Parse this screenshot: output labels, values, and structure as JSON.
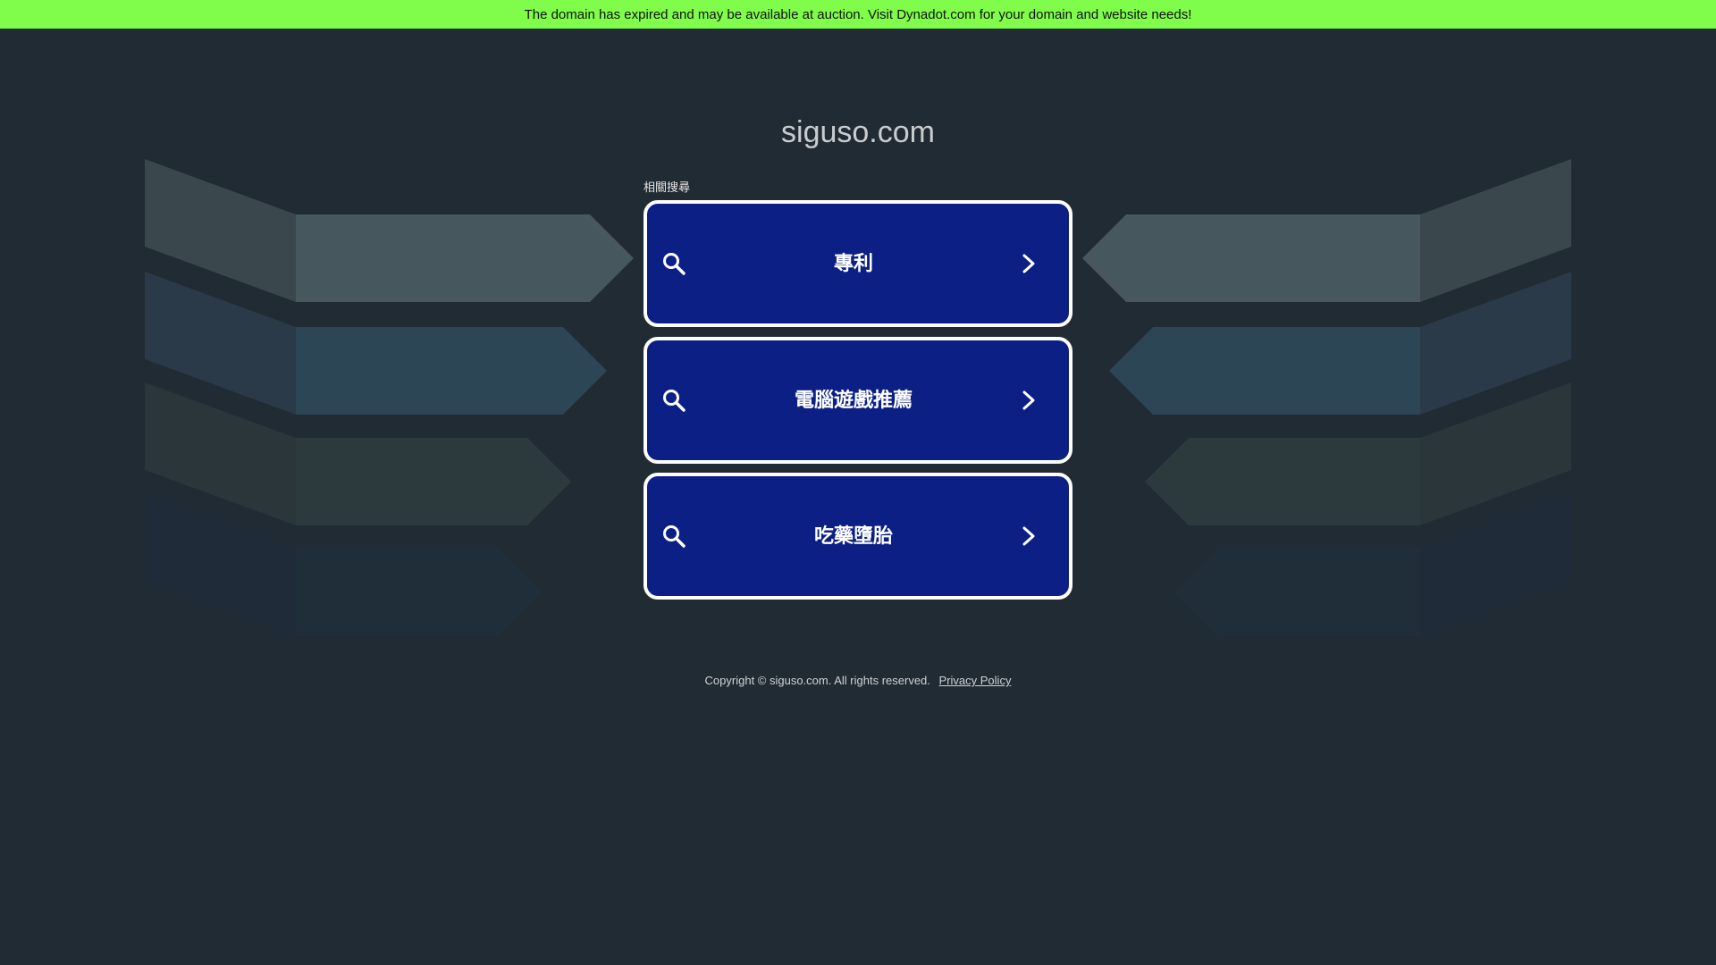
{
  "banner": {
    "text": "The domain has expired and may be available at auction. Visit Dynadot.com for your domain and website needs!"
  },
  "site": {
    "title": "siguso.com"
  },
  "related": {
    "label": "相關搜尋",
    "items": [
      {
        "label": "專利"
      },
      {
        "label": "電腦遊戲推薦"
      },
      {
        "label": "吃藥墮胎"
      }
    ]
  },
  "footer": {
    "copyright": "Copyright © siguso.com.  All rights reserved.",
    "privacy_label": "Privacy Policy"
  },
  "colors": {
    "banner_bg": "#80fc4b",
    "page_bg": "#212b33",
    "button_bg": "#0b1f85",
    "button_border": "#ffffff"
  },
  "icons": {
    "search": "search-icon",
    "chevron": "chevron-right-icon"
  }
}
